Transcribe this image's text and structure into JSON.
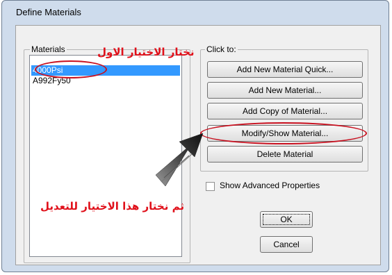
{
  "window": {
    "title": "Define Materials"
  },
  "materials_group": {
    "legend": "Materials",
    "items": [
      {
        "label": "4000Psi",
        "selected": true
      },
      {
        "label": "A992Fy50",
        "selected": false
      }
    ]
  },
  "actions_group": {
    "legend": "Click to:",
    "buttons": {
      "add_quick": "Add New Material Quick...",
      "add_new": "Add New Material...",
      "add_copy": "Add Copy of Material...",
      "modify_show": "Modify/Show Material...",
      "delete": "Delete Material"
    },
    "show_advanced": {
      "label": "Show Advanced Properties",
      "checked": false
    }
  },
  "dialog_buttons": {
    "ok": "OK",
    "cancel": "Cancel"
  },
  "annotations": {
    "first_choice": "نختار الاختيار الاول",
    "then_choice": "ثم نختار هذا الاختيار للتعديل",
    "color": "#e0101a"
  },
  "colors": {
    "selection": "#3399ff",
    "frame": "#cfdcec",
    "annotation_outline": "#c8101f"
  }
}
